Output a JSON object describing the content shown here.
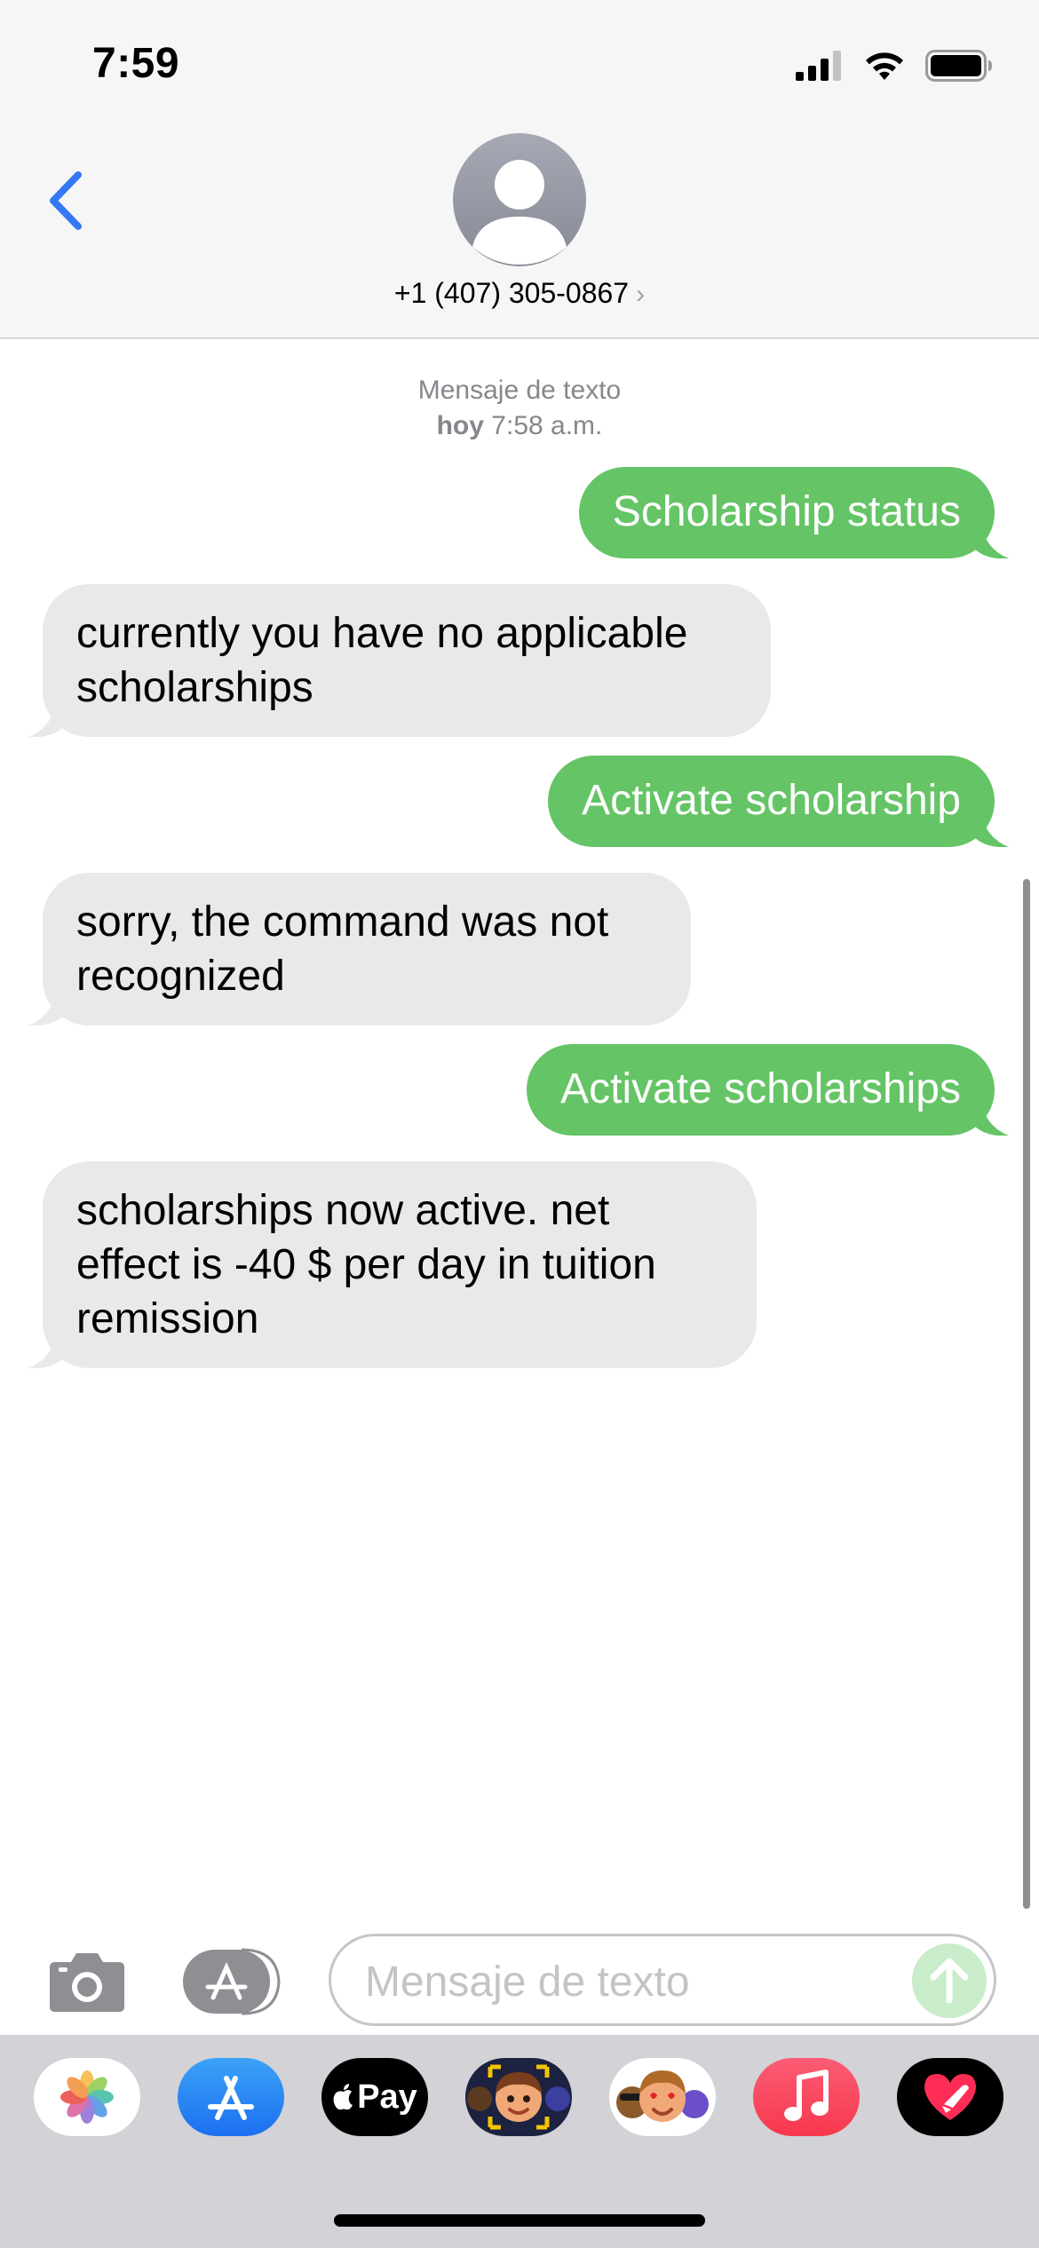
{
  "status_bar": {
    "time": "7:59"
  },
  "header": {
    "contact_number": "+1 (407) 305-0867",
    "chevron": "›"
  },
  "conversation": {
    "meta_line1": "Mensaje de texto",
    "meta_day": "hoy",
    "meta_time": "7:58 a.m.",
    "messages": [
      {
        "direction": "sent",
        "text": "Scholarship status"
      },
      {
        "direction": "received",
        "text": "currently you have no applicable scholarships"
      },
      {
        "direction": "sent",
        "text": "Activate scholarship"
      },
      {
        "direction": "received",
        "text": "sorry, the command was not recognized"
      },
      {
        "direction": "sent",
        "text": "Activate scholarships"
      },
      {
        "direction": "received",
        "text": "scholarships now active. net effect is -40 $ per day in tuition remission"
      }
    ]
  },
  "input": {
    "placeholder": "Mensaje de texto"
  },
  "app_drawer": {
    "apps": [
      {
        "icon": "photos-icon"
      },
      {
        "icon": "app-store-icon"
      },
      {
        "icon": "apple-pay-icon",
        "label": "Pay"
      },
      {
        "icon": "memoji-icon"
      },
      {
        "icon": "animoji-stickers-icon"
      },
      {
        "icon": "music-icon"
      },
      {
        "icon": "digital-touch-icon"
      }
    ]
  },
  "colors": {
    "sent_bubble": "#65c466",
    "received_bubble": "#e9e9eb",
    "accent_blue": "#3478f6",
    "meta_text": "#86868c"
  }
}
